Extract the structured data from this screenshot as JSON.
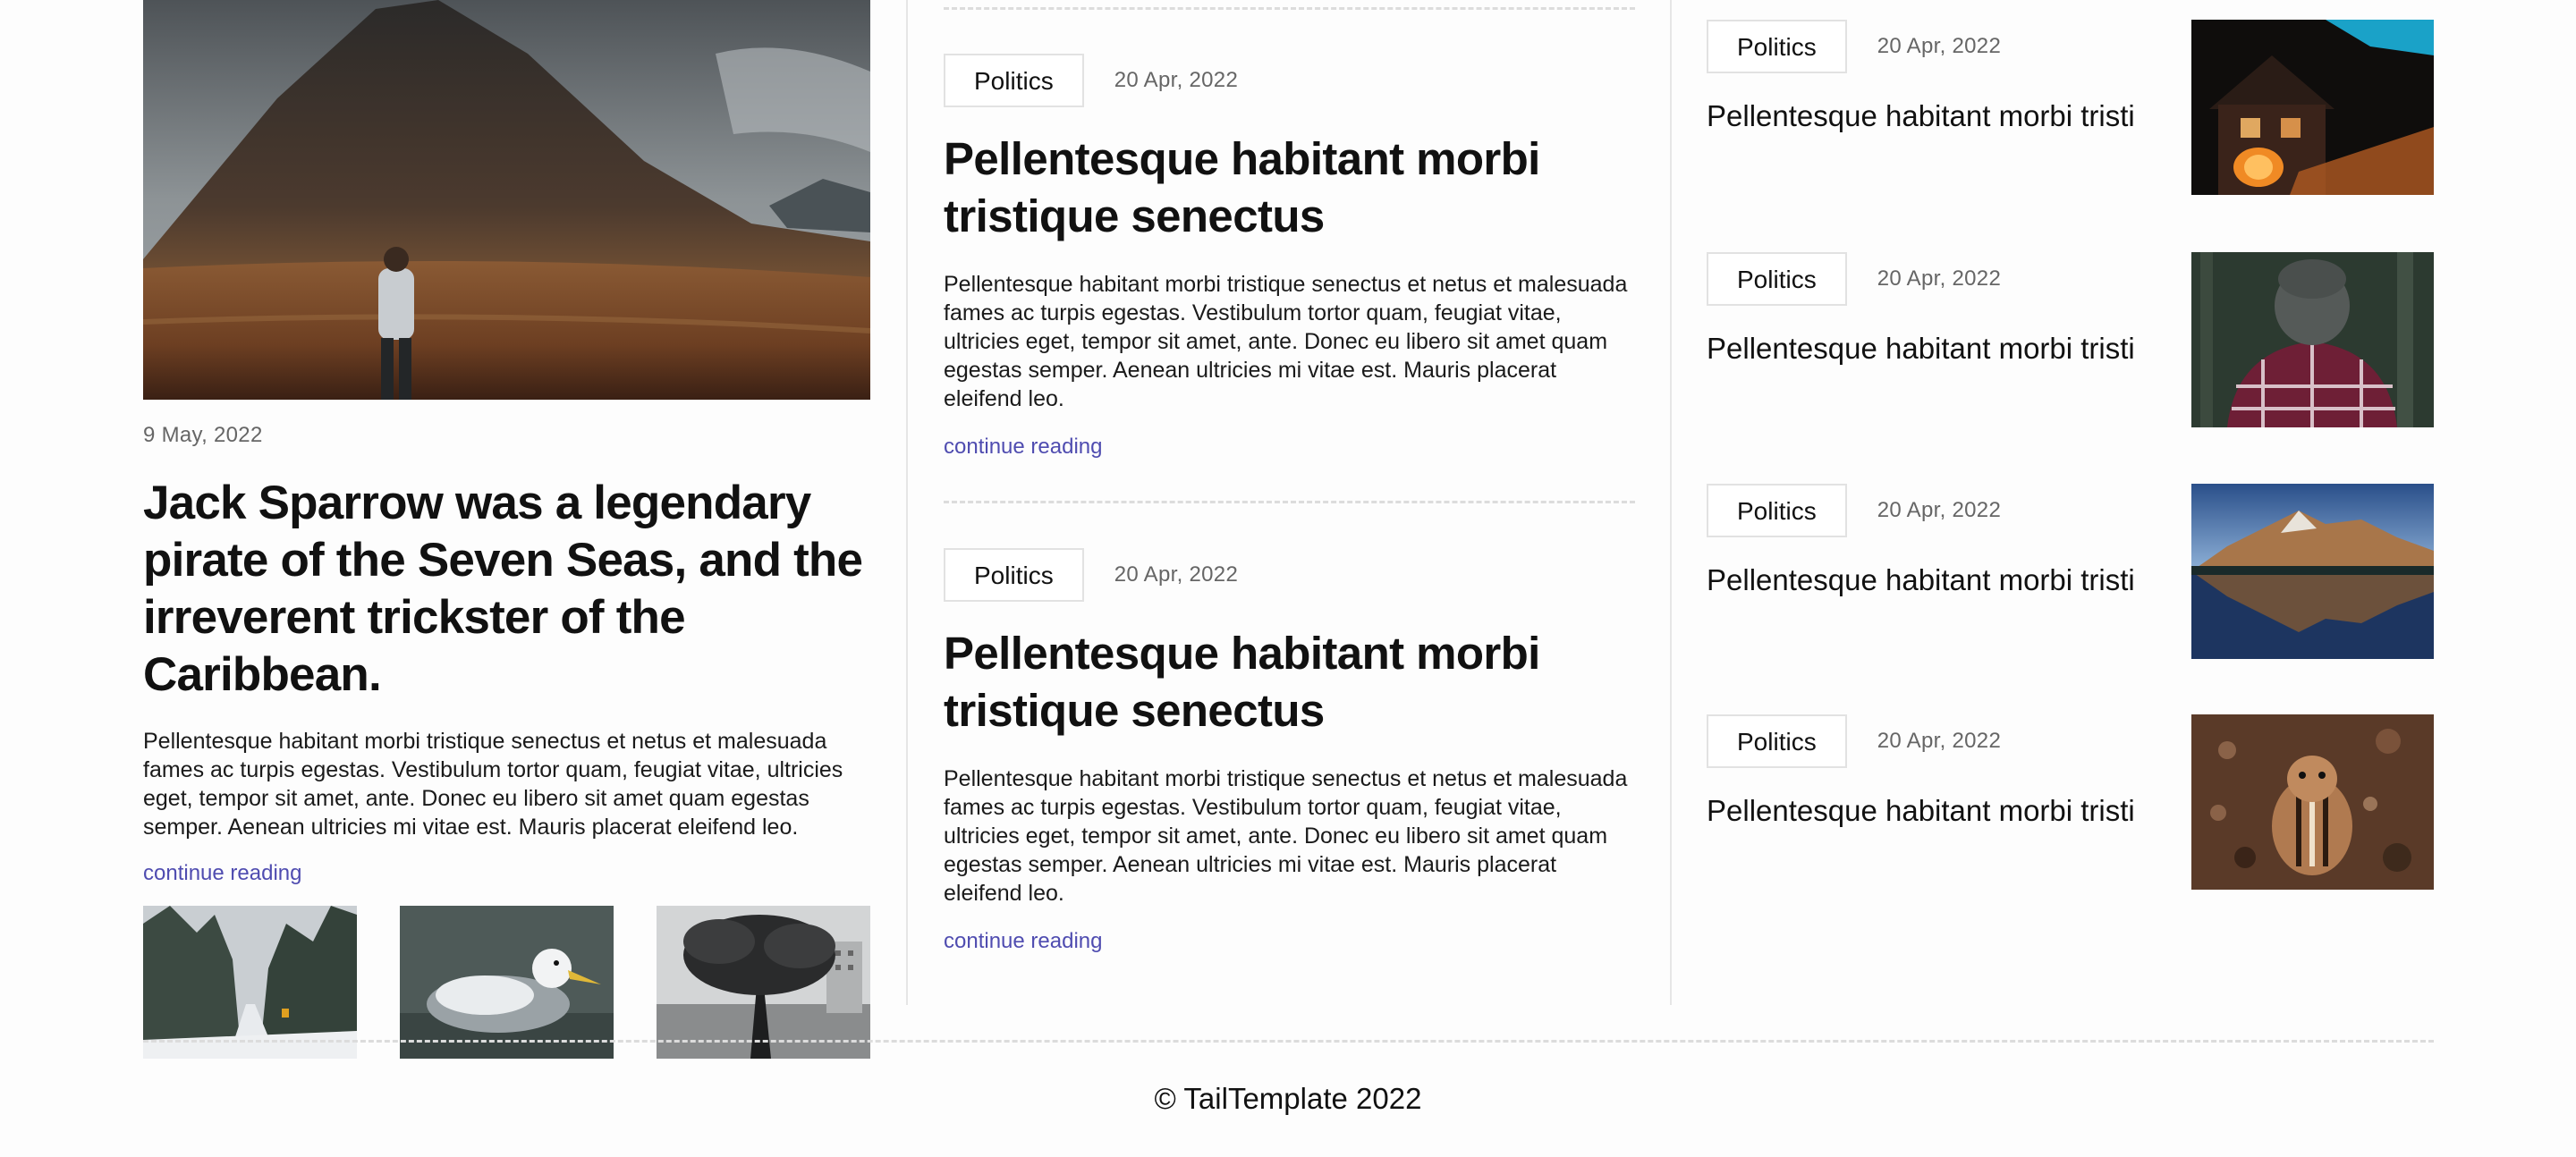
{
  "featured": {
    "date": "9 May, 2022",
    "title": "Jack Sparrow was a legendary pirate of the Seven Seas, and the irreverent trickster of the Caribbean.",
    "excerpt": "Pellentesque habitant morbi tristique senectus et netus et malesuada fames ac turpis egestas. Vestibulum tortor quam, feugiat vitae, ultricies eget, tempor sit amet, ante. Donec eu libero sit amet quam egestas semper. Aenean ultricies mi vitae est. Mauris placerat eleifend leo.",
    "link": "continue reading",
    "image": "person standing before mountain",
    "thumbnails": [
      "snowy forest road",
      "seagull on water",
      "black and white tree by harbor"
    ]
  },
  "posts": [
    {
      "category": "Politics",
      "date": "20 Apr, 2022",
      "title": "Pellentesque habitant morbi tristique senectus",
      "excerpt": "Pellentesque habitant morbi tristique senectus et netus et malesuada fames ac turpis egestas. Vestibulum tortor quam, feugiat vitae, ultricies eget, tempor sit amet, ante. Donec eu libero sit amet quam egestas semper. Aenean ultricies mi vitae est. Mauris placerat eleifend leo.",
      "link": "continue reading"
    },
    {
      "category": "Politics",
      "date": "20 Apr, 2022",
      "title": "Pellentesque habitant morbi tristique senectus",
      "excerpt": "Pellentesque habitant morbi tristique senectus et netus et malesuada fames ac turpis egestas. Vestibulum tortor quam, feugiat vitae, ultricies eget, tempor sit amet, ante. Donec eu libero sit amet quam egestas semper. Aenean ultricies mi vitae est. Mauris placerat eleifend leo.",
      "link": "continue reading"
    }
  ],
  "side": [
    {
      "category": "Politics",
      "date": "20 Apr, 2022",
      "title": "Pellentesque habitant morbi tristique senectus et netus et m",
      "image": "lit house at night with pumpkin"
    },
    {
      "category": "Politics",
      "date": "20 Apr, 2022",
      "title": "Pellentesque habitant morbi tristique senectus et netus et m",
      "image": "person in plaid shirt and beanie"
    },
    {
      "category": "Politics",
      "date": "20 Apr, 2022",
      "title": "Pellentesque habitant morbi tristique senectus et netus et m",
      "image": "mountain reflected in lake"
    },
    {
      "category": "Politics",
      "date": "20 Apr, 2022",
      "title": "Pellentesque habitant morbi tristique senectus et netus et m",
      "image": "chipmunk on ground"
    }
  ],
  "footer": {
    "copyright": "© TailTemplate 2022"
  },
  "colors": {
    "link": "#4f4cb0",
    "border": "#e2e2e2",
    "muted": "#666666"
  }
}
